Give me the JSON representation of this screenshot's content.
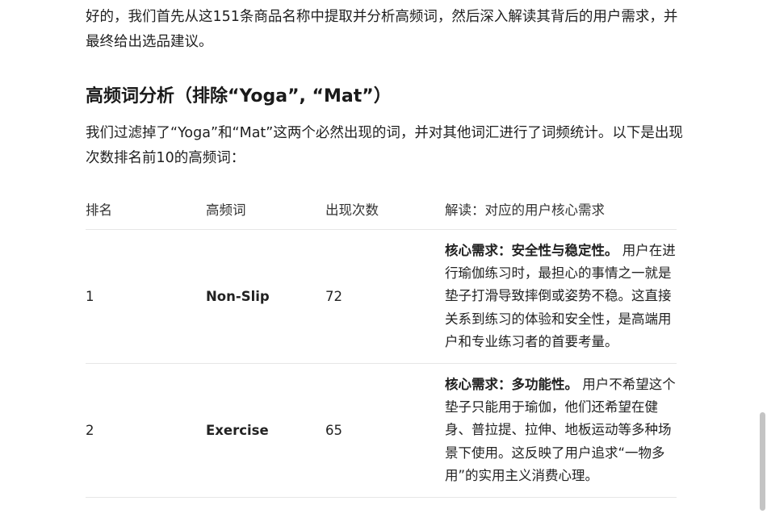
{
  "intro": "好的，我们首先从这151条商品名称中提取并分析高频词，然后深入解读其背后的用户需求，并最终给出选品建议。",
  "heading": "高频词分析（排除“Yoga”, “Mat”）",
  "paragraph": "我们过滤掉了“Yoga”和“Mat”这两个必然出现的词，并对其他词汇进行了词频统计。以下是出现次数排名前10的高频词：",
  "table": {
    "headers": [
      "排名",
      "高频词",
      "出现次数",
      "解读：对应的用户核心需求"
    ],
    "rows": [
      {
        "rank": "1",
        "word": "Non-Slip",
        "count": "72",
        "need_label": "核心需求：安全性与稳定性。",
        "need_text": " 用户在进行瑜伽练习时，最担心的事情之一就是垫子打滑导致摔倒或姿势不稳。这直接关系到练习的体验和安全性，是高端用户和专业练习者的首要考量。"
      },
      {
        "rank": "2",
        "word": "Exercise",
        "count": "65",
        "need_label": "核心需求：多功能性。",
        "need_text": " 用户不希望这个垫子只能用于瑜伽，他们还希望在健身、普拉提、拉伸、地板运动等多种场景下使用。这反映了用户追求“一物多用”的实用主义消费心理。"
      }
    ]
  }
}
